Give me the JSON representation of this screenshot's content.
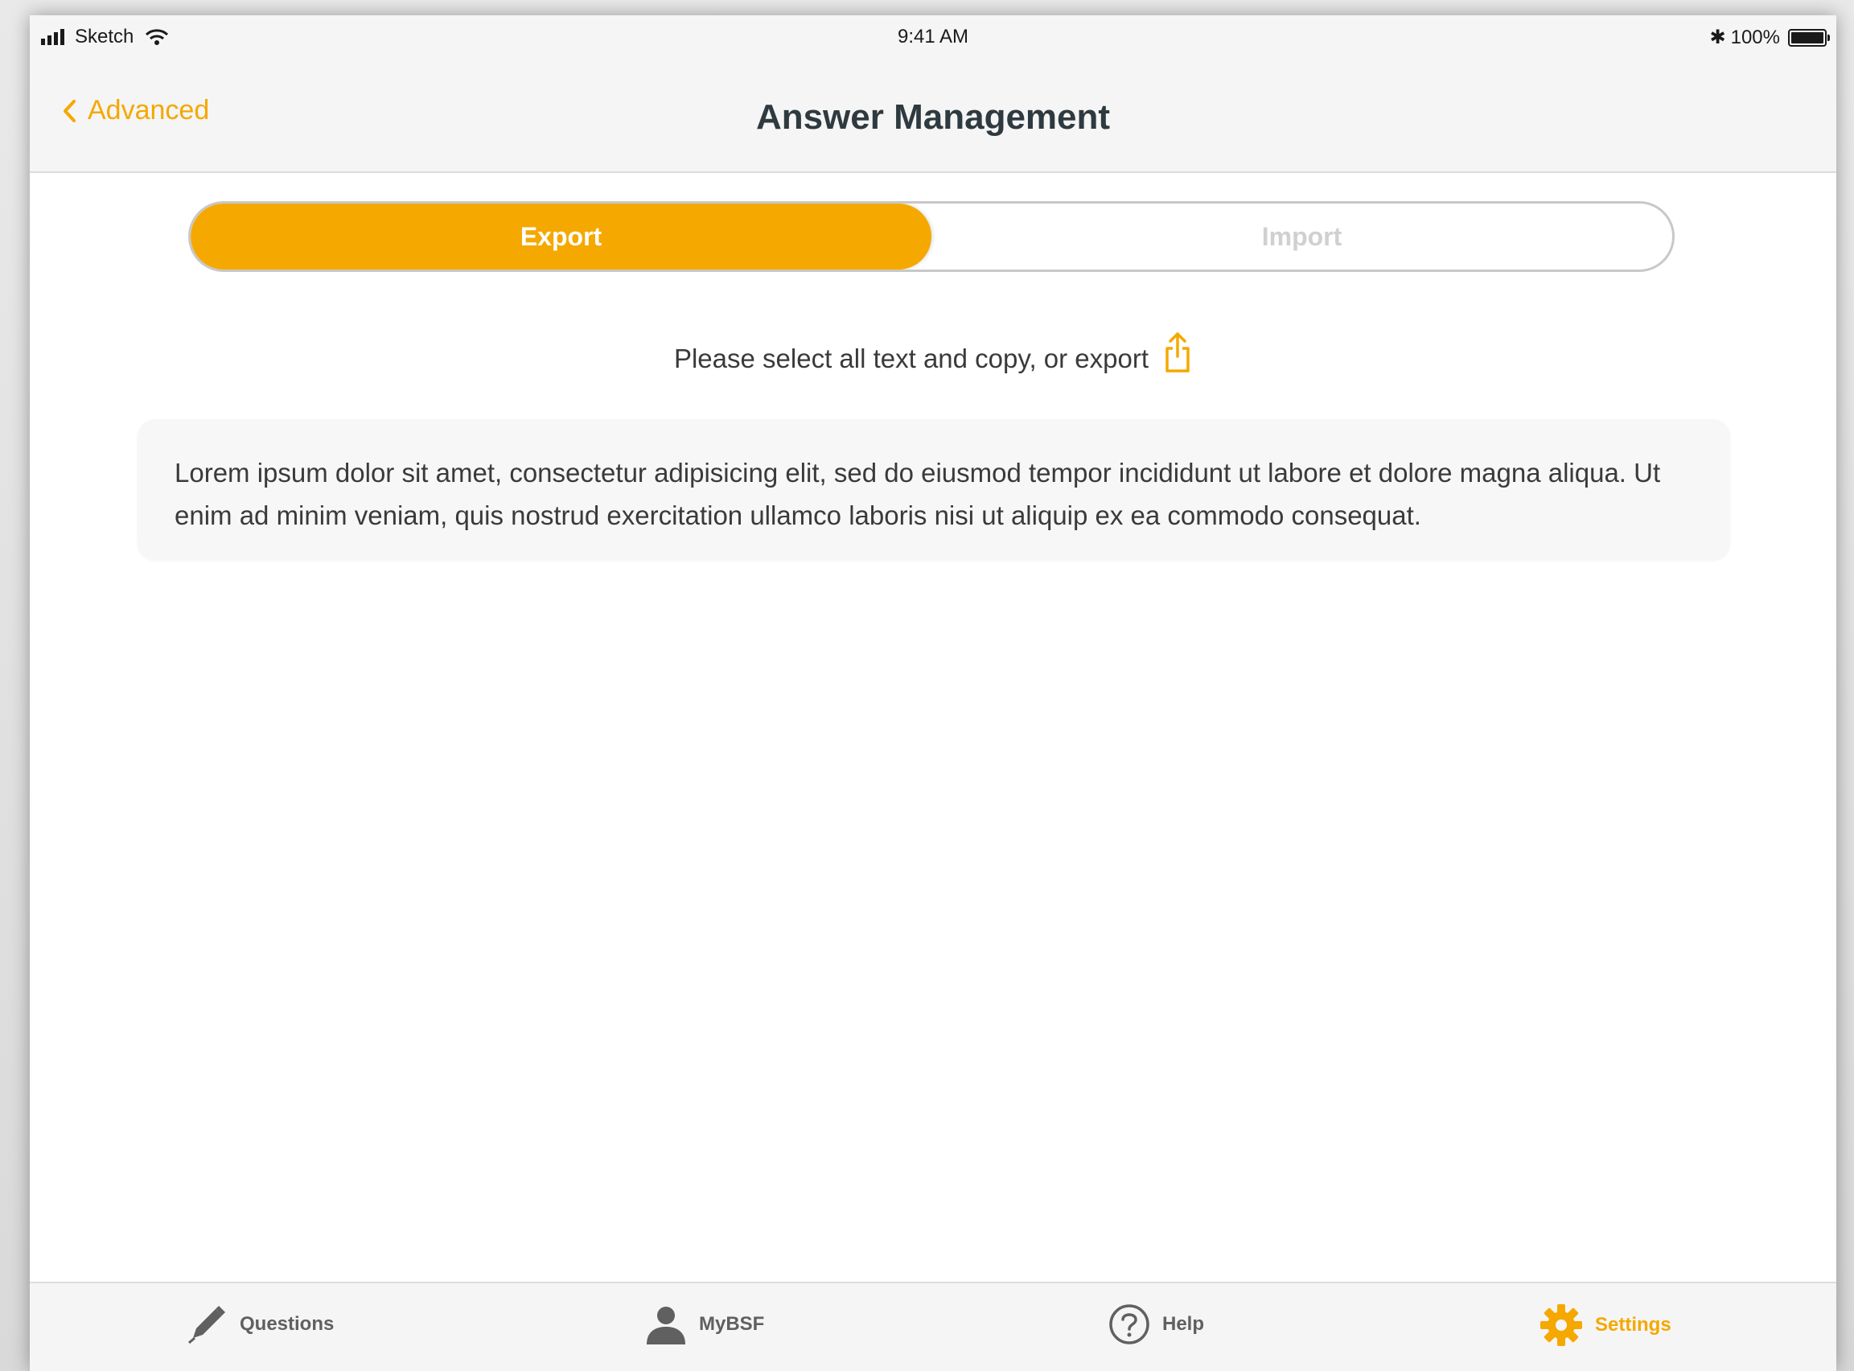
{
  "status_bar": {
    "carrier": "Sketch",
    "time": "9:41 AM",
    "battery": "100%",
    "battery_level": 1.0,
    "icons": [
      "signal-icon",
      "wifi-icon",
      "bluetooth-icon",
      "battery-icon"
    ]
  },
  "nav": {
    "back_label": "Advanced",
    "title": "Answer Management"
  },
  "segment": {
    "options": [
      "Export",
      "Import"
    ],
    "selected": "Export"
  },
  "instruction": {
    "text": "Please select all text and copy, or export",
    "icon": "share-icon"
  },
  "content": {
    "text": "Lorem ipsum dolor sit amet, consectetur adipisicing elit, sed do eiusmod tempor incididunt ut labore et dolore magna aliqua. Ut enim ad minim veniam, quis nostrud exercitation ullamco laboris nisi ut aliquip ex ea commodo consequat."
  },
  "tabs": [
    {
      "label": "Questions",
      "icon": "pencil-icon"
    },
    {
      "label": "MyBSF",
      "icon": "person-icon"
    },
    {
      "label": "Help",
      "icon": "help-icon"
    },
    {
      "label": "Settings",
      "icon": "gear-icon",
      "active": true
    }
  ],
  "colors": {
    "accent": "#f5a800",
    "title": "#2f3a40",
    "inactive": "#606060",
    "background": "#f5f5f5"
  }
}
